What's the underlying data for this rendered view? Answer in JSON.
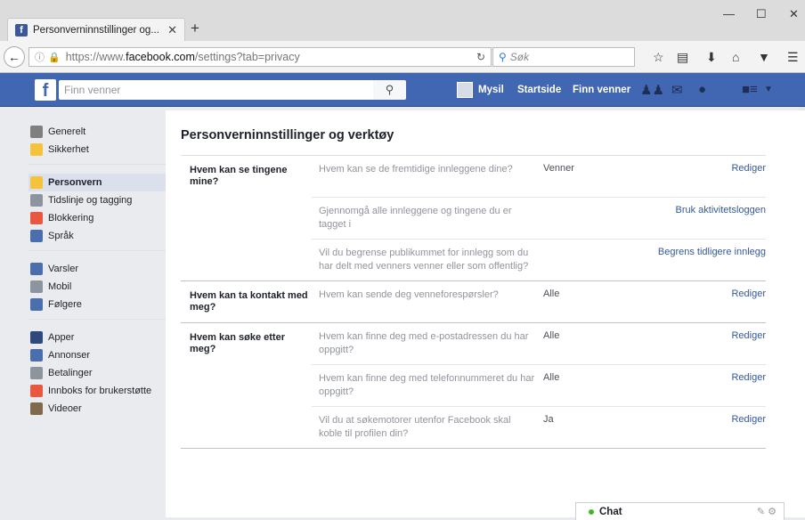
{
  "browser": {
    "tab_title": "Personverninnstillinger og...",
    "tab_close": "✕",
    "new_tab": "+",
    "url_prefix": "https://www.",
    "url_domain": "facebook.com",
    "url_path": "/settings?tab=privacy",
    "search_placeholder": "Søk"
  },
  "fb": {
    "search_placeholder": "Finn venner",
    "user_name": "Mysil",
    "nav_home": "Startside",
    "nav_find_friends": "Finn venner"
  },
  "sidebar": {
    "groups": [
      [
        {
          "label": "Generelt",
          "icon": "gears-icon",
          "color": "#7f7f7f"
        },
        {
          "label": "Sikkerhet",
          "icon": "shield-icon",
          "color": "#f5c33b"
        }
      ],
      [
        {
          "label": "Personvern",
          "icon": "lock-icon",
          "color": "#f5c33b",
          "active": true
        },
        {
          "label": "Tidslinje og tagging",
          "icon": "timeline-icon",
          "color": "#8d949e"
        },
        {
          "label": "Blokkering",
          "icon": "block-icon",
          "color": "#e9573f"
        },
        {
          "label": "Språk",
          "icon": "language-icon",
          "color": "#4b6fad"
        }
      ],
      [
        {
          "label": "Varsler",
          "icon": "globe-icon",
          "color": "#4b6fad"
        },
        {
          "label": "Mobil",
          "icon": "phone-icon",
          "color": "#8d949e"
        },
        {
          "label": "Følgere",
          "icon": "rss-icon",
          "color": "#4b6fad"
        }
      ],
      [
        {
          "label": "Apper",
          "icon": "apps-icon",
          "color": "#2e4a7d"
        },
        {
          "label": "Annonser",
          "icon": "ads-icon",
          "color": "#4b6fad"
        },
        {
          "label": "Betalinger",
          "icon": "card-icon",
          "color": "#8d949e"
        },
        {
          "label": "Innboks for brukerstøtte",
          "icon": "lifebuoy-icon",
          "color": "#e9573f"
        },
        {
          "label": "Videoer",
          "icon": "video-icon",
          "color": "#7f6a4e"
        }
      ]
    ]
  },
  "main": {
    "title": "Personverninnstillinger og verktøy",
    "sections": [
      {
        "heading": "Hvem kan se tingene mine?",
        "rows": [
          {
            "question": "Hvem kan se de fremtidige innleggene dine?",
            "value": "Venner",
            "action": "Rediger"
          },
          {
            "question": "Gjennomgå alle innleggene og tingene du er tagget i",
            "value": "",
            "action": "Bruk aktivitetsloggen"
          },
          {
            "question": "Vil du begrense publikummet for innlegg som du har delt med venners venner eller som offentlig?",
            "value": "",
            "action": "Begrens tidligere innlegg"
          }
        ]
      },
      {
        "heading": "Hvem kan ta kontakt med meg?",
        "rows": [
          {
            "question": "Hvem kan sende deg venneforespørsler?",
            "value": "Alle",
            "action": "Rediger"
          }
        ]
      },
      {
        "heading": "Hvem kan søke etter meg?",
        "rows": [
          {
            "question": "Hvem kan finne deg med e-postadressen du har oppgitt?",
            "value": "Alle",
            "action": "Rediger"
          },
          {
            "question": "Hvem kan finne deg med telefonnummeret du har oppgitt?",
            "value": "Alle",
            "action": "Rediger"
          },
          {
            "question": "Vil du at søkemotorer utenfor Facebook skal koble til profilen din?",
            "value": "Ja",
            "action": "Rediger"
          }
        ]
      }
    ]
  },
  "chat": {
    "label": "Chat"
  }
}
